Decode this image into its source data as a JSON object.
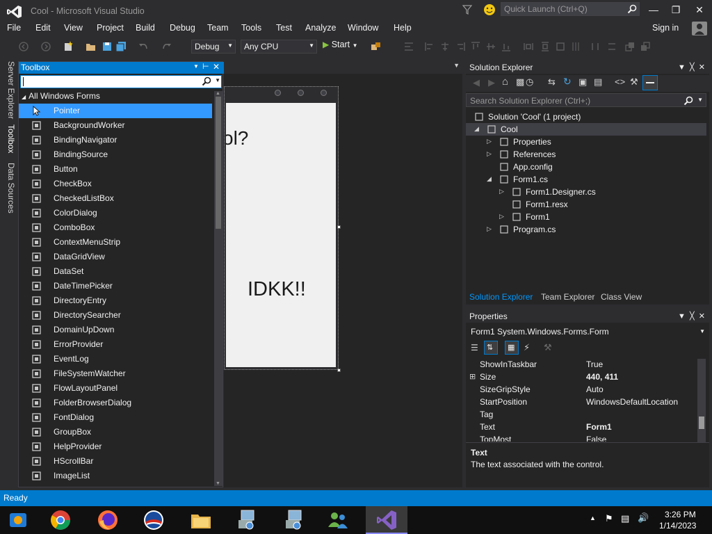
{
  "window": {
    "title": "Cool - Microsoft Visual Studio",
    "quick_launch_placeholder": "Quick Launch (Ctrl+Q)",
    "sign_in": "Sign in"
  },
  "menu": [
    "File",
    "Edit",
    "View",
    "Project",
    "Build",
    "Debug",
    "Team",
    "Tools",
    "Test",
    "Analyze",
    "Window",
    "Help"
  ],
  "toolbar": {
    "config": "Debug",
    "platform": "Any CPU",
    "start": "Start"
  },
  "side_tabs": [
    "Server Explorer",
    "Toolbox",
    "Data Sources"
  ],
  "toolbox": {
    "title": "Toolbox",
    "category": "All Windows Forms",
    "items": [
      {
        "label": "Pointer",
        "icon": "pointer-icon",
        "selected": true
      },
      {
        "label": "BackgroundWorker",
        "icon": "background-worker-icon"
      },
      {
        "label": "BindingNavigator",
        "icon": "binding-navigator-icon"
      },
      {
        "label": "BindingSource",
        "icon": "binding-source-icon"
      },
      {
        "label": "Button",
        "icon": "button-icon"
      },
      {
        "label": "CheckBox",
        "icon": "checkbox-icon"
      },
      {
        "label": "CheckedListBox",
        "icon": "checked-listbox-icon"
      },
      {
        "label": "ColorDialog",
        "icon": "color-dialog-icon"
      },
      {
        "label": "ComboBox",
        "icon": "combobox-icon"
      },
      {
        "label": "ContextMenuStrip",
        "icon": "context-menu-icon"
      },
      {
        "label": "DataGridView",
        "icon": "datagrid-icon"
      },
      {
        "label": "DataSet",
        "icon": "dataset-icon"
      },
      {
        "label": "DateTimePicker",
        "icon": "datetime-picker-icon"
      },
      {
        "label": "DirectoryEntry",
        "icon": "directory-entry-icon"
      },
      {
        "label": "DirectorySearcher",
        "icon": "directory-searcher-icon"
      },
      {
        "label": "DomainUpDown",
        "icon": "domain-updown-icon"
      },
      {
        "label": "ErrorProvider",
        "icon": "error-provider-icon"
      },
      {
        "label": "EventLog",
        "icon": "eventlog-icon"
      },
      {
        "label": "FileSystemWatcher",
        "icon": "filesystem-watcher-icon"
      },
      {
        "label": "FlowLayoutPanel",
        "icon": "flow-layout-icon"
      },
      {
        "label": "FolderBrowserDialog",
        "icon": "folder-browser-icon"
      },
      {
        "label": "FontDialog",
        "icon": "font-dialog-icon"
      },
      {
        "label": "GroupBox",
        "icon": "groupbox-icon"
      },
      {
        "label": "HelpProvider",
        "icon": "help-provider-icon"
      },
      {
        "label": "HScrollBar",
        "icon": "hscrollbar-icon"
      },
      {
        "label": "ImageList",
        "icon": "imagelist-icon"
      }
    ]
  },
  "designer": {
    "label1": "ol?",
    "label2": "IDKK!!"
  },
  "solution_explorer": {
    "title": "Solution Explorer",
    "search_placeholder": "Search Solution Explorer (Ctrl+;)",
    "tree": [
      {
        "label": "Solution 'Cool' (1 project)",
        "level": 0,
        "arrow": "",
        "icon": "solution-icon"
      },
      {
        "label": "Cool",
        "level": 0,
        "arrow": "down",
        "icon": "csharp-project-icon",
        "selected": true
      },
      {
        "label": "Properties",
        "level": 1,
        "arrow": "right",
        "icon": "wrench-icon"
      },
      {
        "label": "References",
        "level": 1,
        "arrow": "right",
        "icon": "references-icon"
      },
      {
        "label": "App.config",
        "level": 1,
        "arrow": "",
        "icon": "config-file-icon"
      },
      {
        "label": "Form1.cs",
        "level": 1,
        "arrow": "down",
        "icon": "form-icon"
      },
      {
        "label": "Form1.Designer.cs",
        "level": 2,
        "arrow": "right",
        "icon": "cs-file-icon"
      },
      {
        "label": "Form1.resx",
        "level": 2,
        "arrow": "",
        "icon": "resx-file-icon"
      },
      {
        "label": "Form1",
        "level": 2,
        "arrow": "right",
        "icon": "class-icon"
      },
      {
        "label": "Program.cs",
        "level": 1,
        "arrow": "right",
        "icon": "csharp-file-icon"
      }
    ],
    "tabs": [
      {
        "label": "Solution Explorer",
        "active": true
      },
      {
        "label": "Team Explorer"
      },
      {
        "label": "Class View"
      }
    ]
  },
  "properties": {
    "title": "Properties",
    "object_name": "Form1",
    "object_type": "System.Windows.Forms.Form",
    "rows": [
      {
        "name": "ShowInTaskbar",
        "value": "True"
      },
      {
        "name": "Size",
        "value": "440, 411",
        "bold": true,
        "expandable": true
      },
      {
        "name": "SizeGripStyle",
        "value": "Auto"
      },
      {
        "name": "StartPosition",
        "value": "WindowsDefaultLocation"
      },
      {
        "name": "Tag",
        "value": ""
      },
      {
        "name": "Text",
        "value": "Form1",
        "bold": true
      },
      {
        "name": "TopMost",
        "value": "False"
      }
    ],
    "description_title": "Text",
    "description": "The text associated with the control."
  },
  "status": "Ready",
  "taskbar": {
    "time": "3:26 PM",
    "date": "1/14/2023",
    "apps": [
      "media-center-icon",
      "chrome-icon",
      "firefox-icon",
      "campaign-icon",
      "file-explorer-icon",
      "network-setup-icon",
      "network-setup-2-icon",
      "users-icon",
      "visual-studio-icon"
    ]
  },
  "colors": {
    "accent": "#007acc",
    "selection": "#3399ff",
    "background": "#2d2d30",
    "panel": "#252526"
  }
}
